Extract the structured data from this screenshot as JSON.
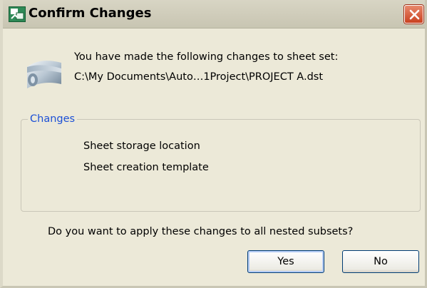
{
  "window": {
    "title": "Confirm Changes"
  },
  "message": {
    "line1": "You have made the following changes to sheet set:",
    "line2": "C:\\My Documents\\Auto…1Project\\PROJECT A.dst"
  },
  "changes": {
    "legend": "Changes",
    "items": [
      {
        "label": "Sheet storage location"
      },
      {
        "label": "Sheet creation template"
      }
    ]
  },
  "question": "Do you want to apply these changes to all nested subsets?",
  "buttons": {
    "yes_label": "Yes",
    "no_label": "No"
  },
  "colors": {
    "dialog_bg": "#ece9d8",
    "legend_text": "#1c50d6",
    "close_button": "#d9512c",
    "button_border": "#003c74"
  },
  "icons": {
    "app": "sheet-set-app-icon",
    "close": "close-icon",
    "sheet_set": "sheet-set-icon"
  }
}
